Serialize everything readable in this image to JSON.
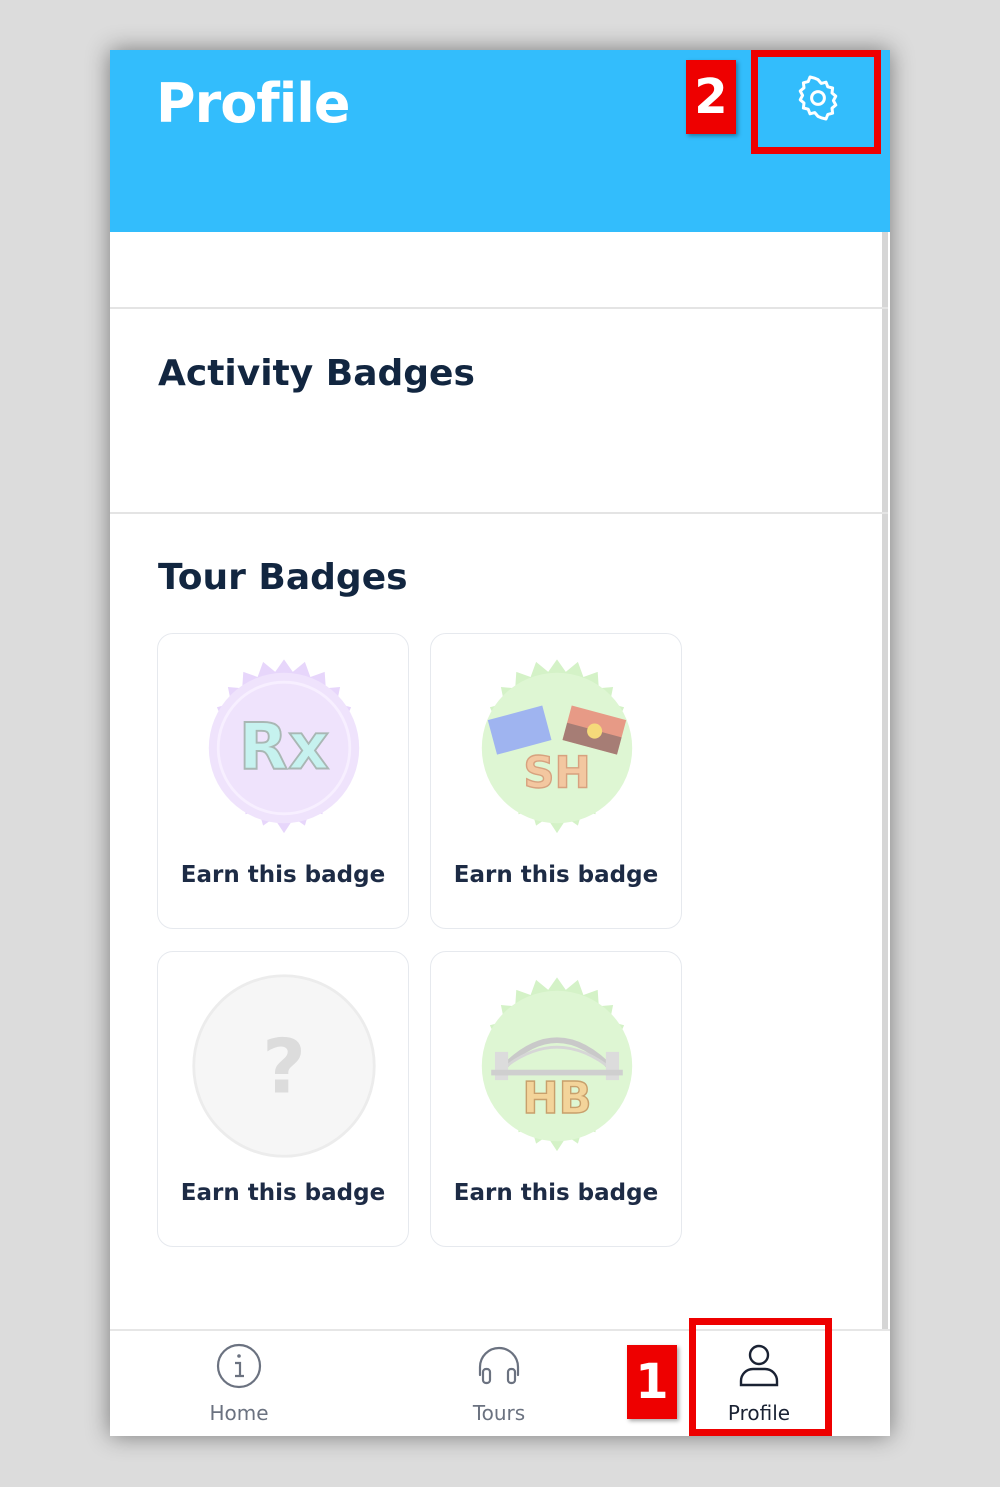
{
  "header": {
    "title": "Profile",
    "settings_icon": "gear-icon",
    "background": "#33bdfc"
  },
  "sections": {
    "activity_title": "Activity Badges",
    "tour_title": "Tour Badges"
  },
  "tour_badges": [
    {
      "label": "Earn this badge",
      "icon": "rx-badge",
      "emblem": "Rx"
    },
    {
      "label": "Earn this badge",
      "icon": "sh-badge-flags",
      "emblem": "SH"
    },
    {
      "label": "Earn this badge",
      "icon": "question-mark-badge",
      "emblem": "?"
    },
    {
      "label": "Earn this badge",
      "icon": "hb-badge-bridge",
      "emblem": "HB"
    }
  ],
  "tabbar": {
    "items": [
      {
        "label": "Home",
        "icon": "info-icon"
      },
      {
        "label": "Tours",
        "icon": "headphones-icon"
      },
      {
        "label": "Profile",
        "icon": "user-icon",
        "active": true
      }
    ]
  },
  "annotations": [
    {
      "number": "1"
    },
    {
      "number": "2"
    }
  ],
  "colors": {
    "accent": "#33bdfc",
    "title_text": "#122640",
    "annotation_red": "#ee0000"
  }
}
